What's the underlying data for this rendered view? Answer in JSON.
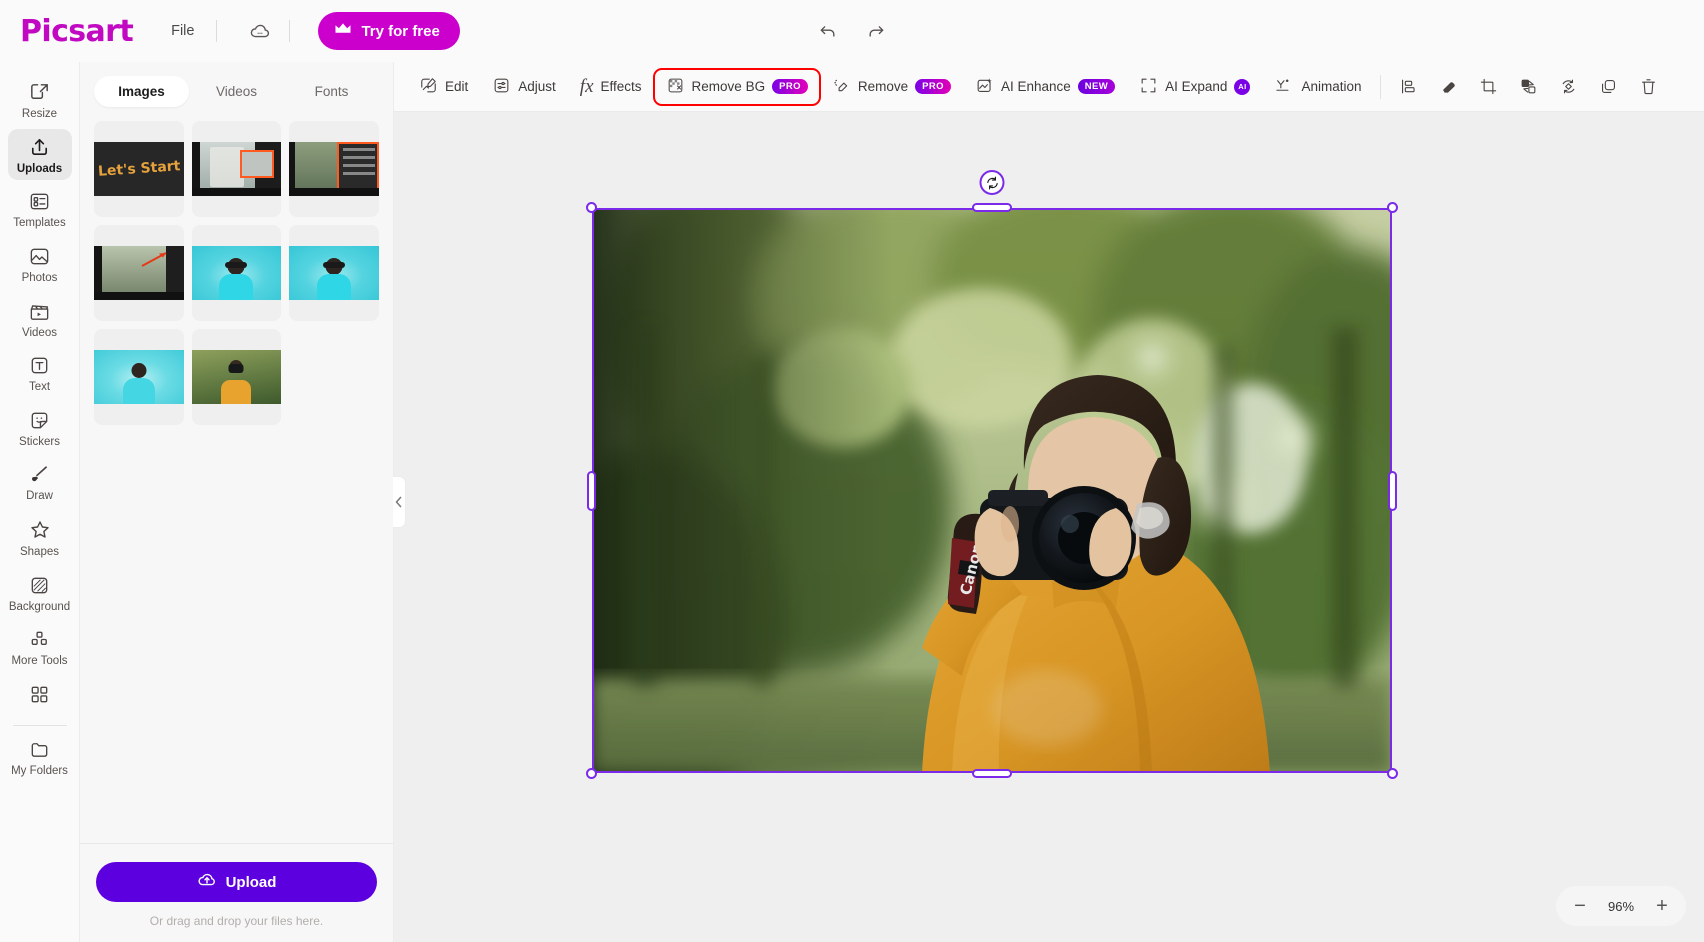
{
  "topbar": {
    "logo": "Picsart",
    "file_menu": "File",
    "cloud_icon": "cloud-saved-icon",
    "try_free_label": "Try for free",
    "crown_icon": "crown-icon",
    "undo_icon": "undo-arrow-icon",
    "redo_icon": "redo-arrow-icon"
  },
  "rail": {
    "items": [
      {
        "label": "Resize",
        "icon": "resize-icon",
        "active": false
      },
      {
        "label": "Uploads",
        "icon": "upload-arrow-icon",
        "active": true
      },
      {
        "label": "Templates",
        "icon": "templates-icon",
        "active": false
      },
      {
        "label": "Photos",
        "icon": "photo-icon",
        "active": false
      },
      {
        "label": "Videos",
        "icon": "clapperboard-icon",
        "active": false
      },
      {
        "label": "Text",
        "icon": "text-box-icon",
        "active": false
      },
      {
        "label": "Stickers",
        "icon": "sticker-icon",
        "active": false
      },
      {
        "label": "Draw",
        "icon": "paintbrush-icon",
        "active": false
      },
      {
        "label": "Shapes",
        "icon": "star-icon",
        "active": false
      },
      {
        "label": "Background",
        "icon": "background-icon",
        "active": false
      },
      {
        "label": "More Tools",
        "icon": "grid-dots-icon",
        "active": false
      },
      {
        "label": "",
        "icon": "apps-grid-icon",
        "active": false
      },
      {
        "label": "My Folders",
        "icon": "folder-icon",
        "active": false
      }
    ]
  },
  "panel": {
    "tabs": [
      {
        "label": "Images",
        "active": true
      },
      {
        "label": "Videos",
        "active": false
      },
      {
        "label": "Fonts",
        "active": false
      }
    ],
    "thumbnails": [
      {
        "name": "lets-start-dark-banner",
        "kind": "text-banner",
        "caption": "Let's Start"
      },
      {
        "name": "screenshot-editor-white",
        "kind": "screenshot-light"
      },
      {
        "name": "screenshot-editor-menu",
        "kind": "screenshot-menu"
      },
      {
        "name": "screenshot-arrow-annotated",
        "kind": "screenshot-arrow"
      },
      {
        "name": "portrait-cyan-cutout-1",
        "kind": "cyan-portrait"
      },
      {
        "name": "portrait-cyan-cutout-2",
        "kind": "cyan-portrait"
      },
      {
        "name": "portrait-cyan-cutout-3",
        "kind": "cyan-portrait"
      },
      {
        "name": "photographer-orange-sweater",
        "kind": "photographer"
      }
    ],
    "upload_button": "Upload",
    "upload_icon": "upload-cloud-icon",
    "drag_hint": "Or drag and drop your files here.",
    "collapse_icon": "chevron-left-icon"
  },
  "toolbar": {
    "tools": [
      {
        "label": "Edit",
        "icon": "edit-image-icon",
        "badge": "",
        "highlight": false
      },
      {
        "label": "Adjust",
        "icon": "adjust-sliders-icon",
        "badge": "",
        "highlight": false
      },
      {
        "label": "Effects",
        "icon": "fx-icon",
        "badge": "",
        "highlight": false
      },
      {
        "label": "Remove BG",
        "icon": "remove-bg-icon",
        "badge": "PRO",
        "highlight": true
      },
      {
        "label": "Remove",
        "icon": "eraser-wand-icon",
        "badge": "PRO",
        "highlight": false
      },
      {
        "label": "AI Enhance",
        "icon": "ai-enhance-icon",
        "badge": "NEW",
        "highlight": false
      },
      {
        "label": "AI Expand",
        "icon": "expand-arrows-icon",
        "badge": "AI",
        "highlight": false
      },
      {
        "label": "Animation",
        "icon": "animation-icon",
        "badge": "",
        "highlight": false
      }
    ],
    "icon_tools": [
      {
        "icon": "align-icon",
        "name": "align-button"
      },
      {
        "icon": "eraser-icon",
        "name": "eraser-button"
      },
      {
        "icon": "crop-icon",
        "name": "crop-button"
      },
      {
        "icon": "flip-icon",
        "name": "flip-button"
      },
      {
        "icon": "rotate-icon",
        "name": "rotate-button"
      },
      {
        "icon": "duplicate-icon",
        "name": "duplicate-button"
      },
      {
        "icon": "trash-icon",
        "name": "delete-button"
      }
    ]
  },
  "canvas": {
    "selection": {
      "rotate_icon": "rotate-handle-icon"
    },
    "image_alt": "woman-photographer-with-camera-in-park",
    "zoom": {
      "value": "96%",
      "minus": "−",
      "plus": "+"
    }
  },
  "colors": {
    "brand_magenta": "#cc00cc",
    "upload_purple": "#5c00e0",
    "selection_purple": "#7a2ae8",
    "highlight_red": "#ff0000",
    "sweater_orange": "#e8a32e"
  }
}
